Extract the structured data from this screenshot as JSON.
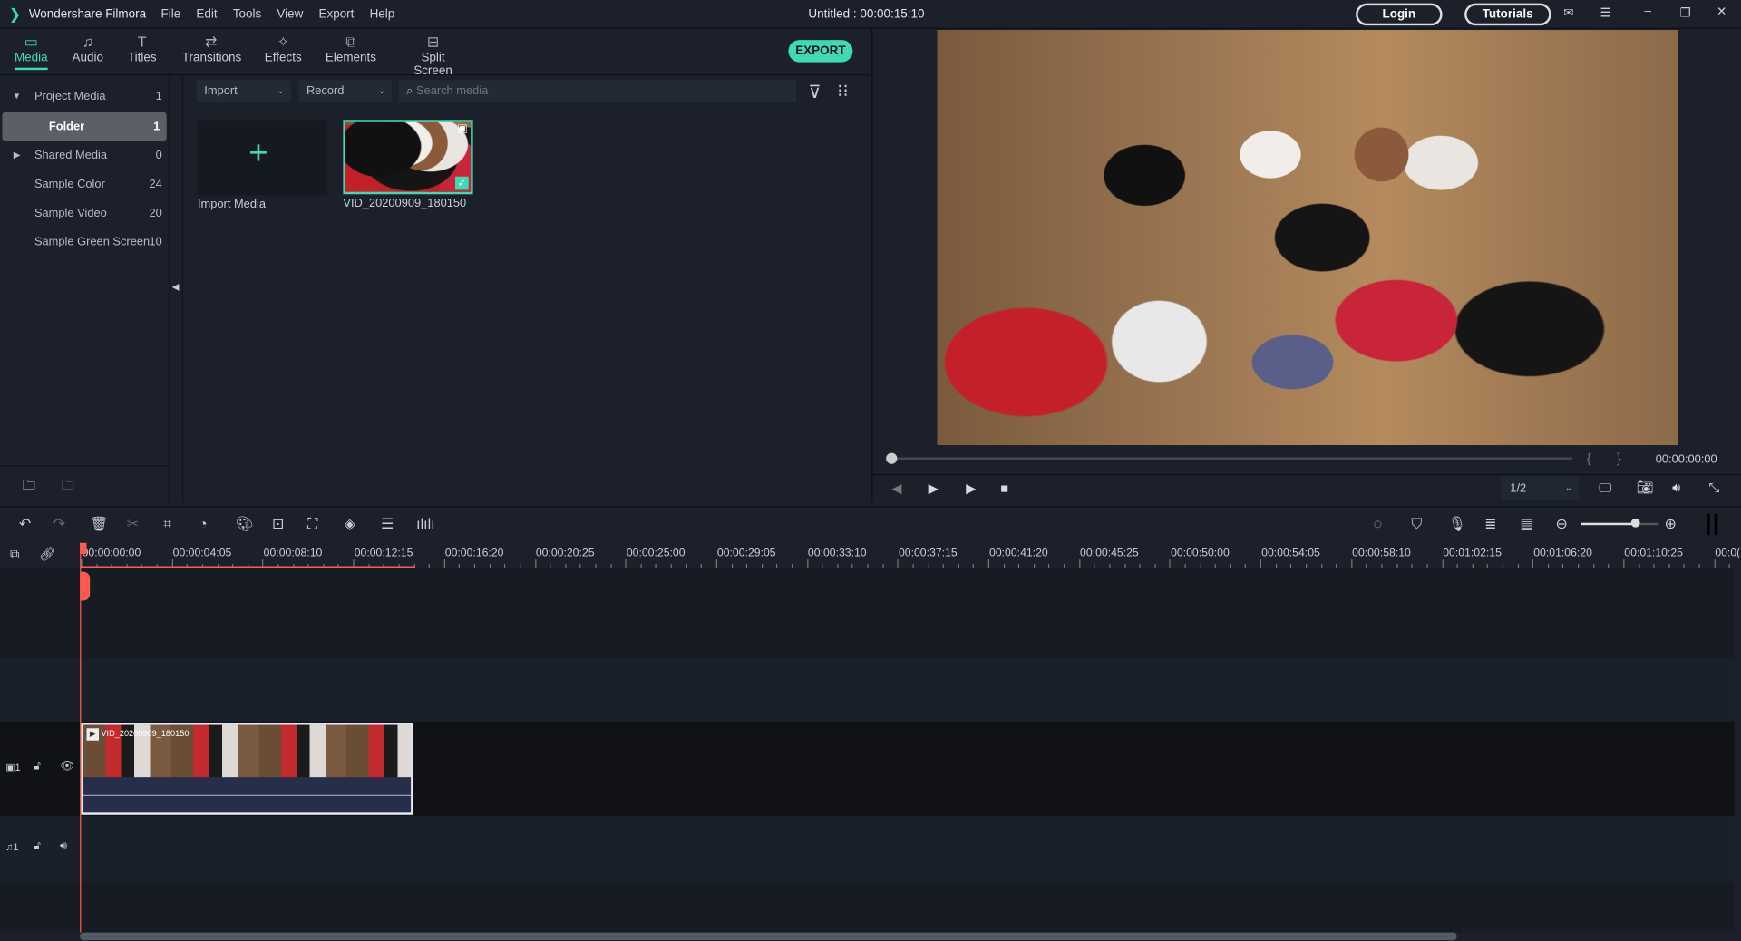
{
  "app": {
    "name": "Wondershare Filmora",
    "title": "Untitled : 00:00:15:10",
    "menu": [
      "File",
      "Edit",
      "Tools",
      "View",
      "Export",
      "Help"
    ],
    "login": "Login",
    "tutorials": "Tutorials"
  },
  "tabs": [
    {
      "label": "Media",
      "icon": "folder-icon"
    },
    {
      "label": "Audio",
      "icon": "music-icon"
    },
    {
      "label": "Titles",
      "icon": "text-icon"
    },
    {
      "label": "Transitions",
      "icon": "transition-icon"
    },
    {
      "label": "Effects",
      "icon": "effects-icon"
    },
    {
      "label": "Elements",
      "icon": "elements-icon"
    },
    {
      "label": "Split Screen",
      "icon": "split-screen-icon"
    }
  ],
  "export_label": "EXPORT",
  "sidebar": [
    {
      "label": "Project Media",
      "count": "1"
    },
    {
      "label": "Folder",
      "count": "1"
    },
    {
      "label": "Shared Media",
      "count": "0"
    },
    {
      "label": "Sample Color",
      "count": "24"
    },
    {
      "label": "Sample Video",
      "count": "20"
    },
    {
      "label": "Sample Green Screen",
      "count": "10"
    }
  ],
  "media": {
    "import_dropdown": "Import",
    "record_dropdown": "Record",
    "search_placeholder": "Search media",
    "import_label": "Import Media",
    "clip_name": "VID_20200909_180150"
  },
  "preview": {
    "timecode": "00:00:00:00",
    "quality": "1/2",
    "progress": 0
  },
  "timeline": {
    "ruler": [
      "00:00:00:00",
      "00:00:04:05",
      "00:00:08:10",
      "00:00:12:15",
      "00:00:16:20",
      "00:00:20:25",
      "00:00:25:00",
      "00:00:29:05",
      "00:00:33:10",
      "00:00:37:15",
      "00:00:41:20",
      "00:00:45:25",
      "00:00:50:00",
      "00:00:54:05",
      "00:00:58:10",
      "00:01:02:15",
      "00:01:06:20",
      "00:01:10:25",
      "00:0("
    ],
    "clip_name": "VID_20200909_180150",
    "video_track": "1",
    "audio_track": "1",
    "zoom_level": 0.7
  },
  "colors": {
    "accent": "#3fd9b4",
    "playhead": "#ff5a52"
  }
}
